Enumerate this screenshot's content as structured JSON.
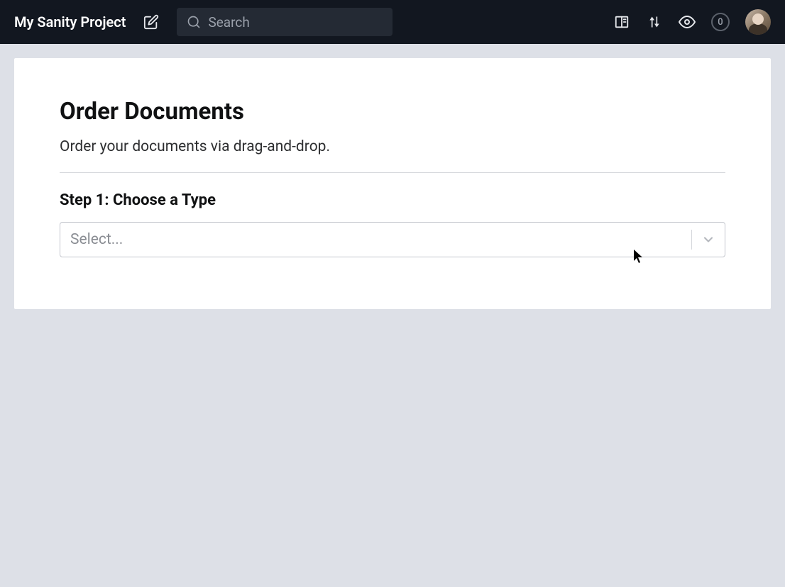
{
  "header": {
    "project_title": "My Sanity Project",
    "search_placeholder": "Search",
    "badge_count": "0"
  },
  "main": {
    "title": "Order Documents",
    "subtitle": "Order your documents via drag-and-drop.",
    "step_title": "Step 1: Choose a Type",
    "select_placeholder": "Select..."
  }
}
